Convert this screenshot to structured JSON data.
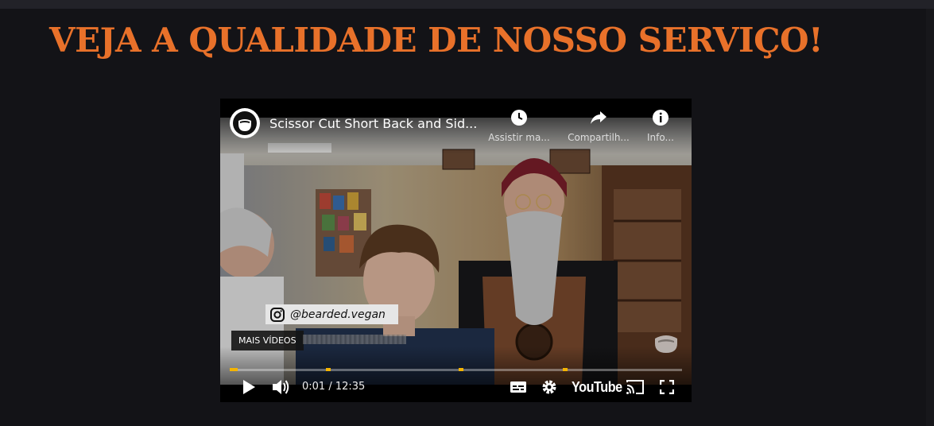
{
  "page": {
    "heading": "VEJA A QUALIDADE DE NOSSO SERVIÇO!"
  },
  "colors": {
    "heading": "#e8712a",
    "background": "#131317",
    "chapter_marker": "#f4b400"
  },
  "player": {
    "title": "Scissor Cut Short Back and Sid...",
    "actions": [
      {
        "icon": "watch-later-icon",
        "label": "Assistir ma..."
      },
      {
        "icon": "share-icon",
        "label": "Compartilh..."
      },
      {
        "icon": "info-icon",
        "label": "Info..."
      }
    ],
    "overlay_handle": "@bearded.vegan",
    "more_videos_label": "MAIS VÍDEOS",
    "time": "0:01 / 12:35",
    "progress": 0.001,
    "logo_text": "YouTube"
  }
}
